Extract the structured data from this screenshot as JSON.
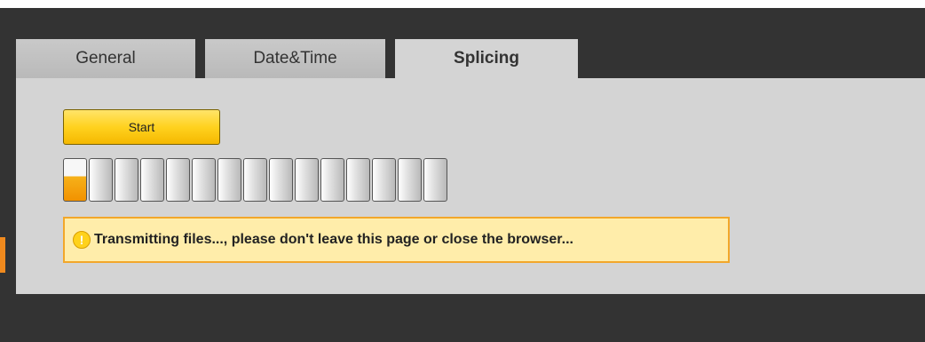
{
  "tabs": [
    {
      "label": "General",
      "active": false
    },
    {
      "label": "Date&Time",
      "active": false
    },
    {
      "label": "Splicing",
      "active": true
    }
  ],
  "start_button": {
    "label": "Start"
  },
  "progress": {
    "segments_total": 15,
    "segments_filled": 1,
    "fraction": 0.067
  },
  "notice": {
    "icon": "warning-icon",
    "text": "Transmitting files..., please don't leave this page or close the browser..."
  },
  "colors": {
    "accent_yellow": "#ffd21f",
    "progress_orange": "#f29200",
    "notice_background": "#ffedaa",
    "notice_border": "#f2a72a",
    "panel": "#d4d4d4",
    "frame": "#333333"
  }
}
